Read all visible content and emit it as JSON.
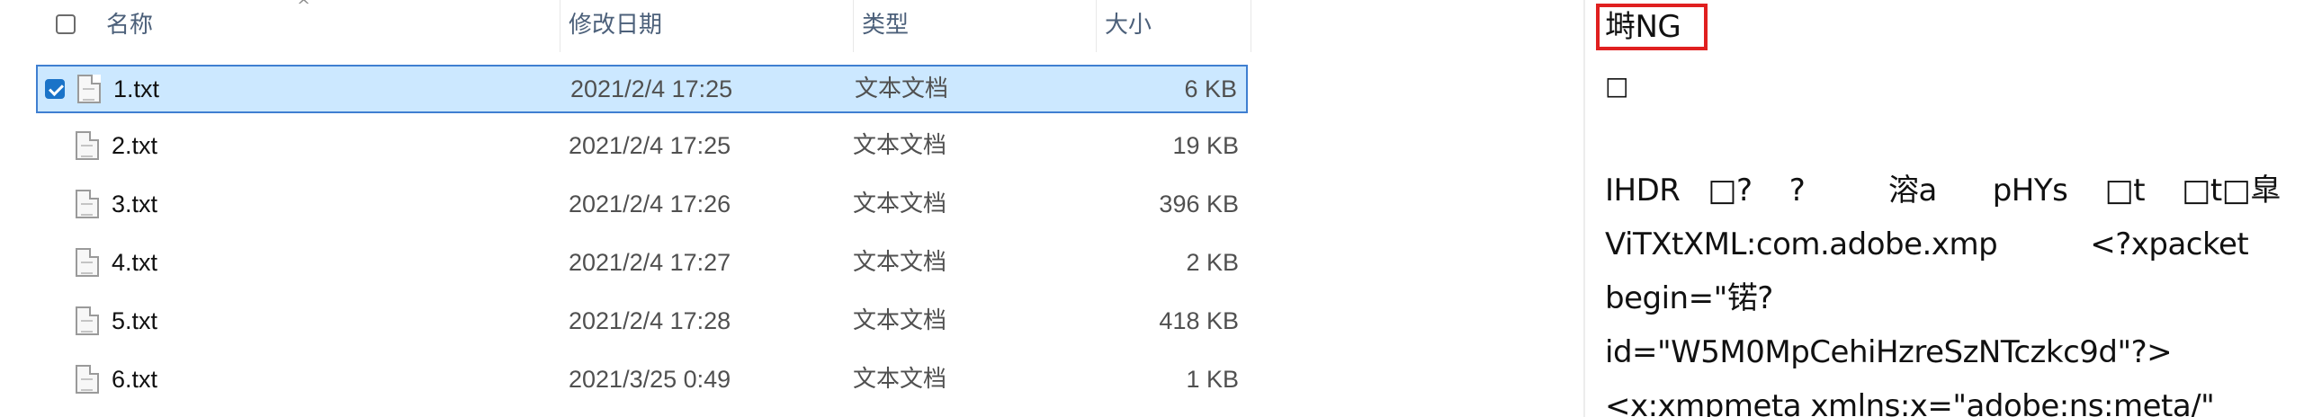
{
  "explorer": {
    "columns": {
      "name": "名称",
      "date": "修改日期",
      "type": "类型",
      "size": "大小"
    },
    "sort_arrow": "^",
    "files": [
      {
        "name": "1.txt",
        "date": "2021/2/4 17:25",
        "type": "文本文档",
        "size": "6 KB",
        "selected": true
      },
      {
        "name": "2.txt",
        "date": "2021/2/4 17:25",
        "type": "文本文档",
        "size": "19 KB",
        "selected": false
      },
      {
        "name": "3.txt",
        "date": "2021/2/4 17:26",
        "type": "文本文档",
        "size": "396 KB",
        "selected": false
      },
      {
        "name": "4.txt",
        "date": "2021/2/4 17:27",
        "type": "文本文档",
        "size": "2 KB",
        "selected": false
      },
      {
        "name": "5.txt",
        "date": "2021/2/4 17:28",
        "type": "文本文档",
        "size": "418 KB",
        "selected": false
      },
      {
        "name": "6.txt",
        "date": "2021/3/25 0:49",
        "type": "文本文档",
        "size": "1 KB",
        "selected": false
      }
    ]
  },
  "viewer": {
    "lines": [
      "塒NG",
      "□",
      "",
      "IHDR   □?    ?         溶a      pHYs    □t    □t□皐   x",
      "ViTXtXML:com.adobe.xmp          <?xpacket",
      "begin=\"锘?",
      "id=\"W5M0MpCehiHzreSzNTczkc9d\"?>",
      "<x:xmpmeta xmlns:x=\"adobe:ns:meta/\""
    ]
  },
  "colors": {
    "selection_bg": "#cce8ff",
    "selection_border": "#3f7fd1",
    "highlight_border": "#e02020",
    "header_text": "#4c607a"
  }
}
